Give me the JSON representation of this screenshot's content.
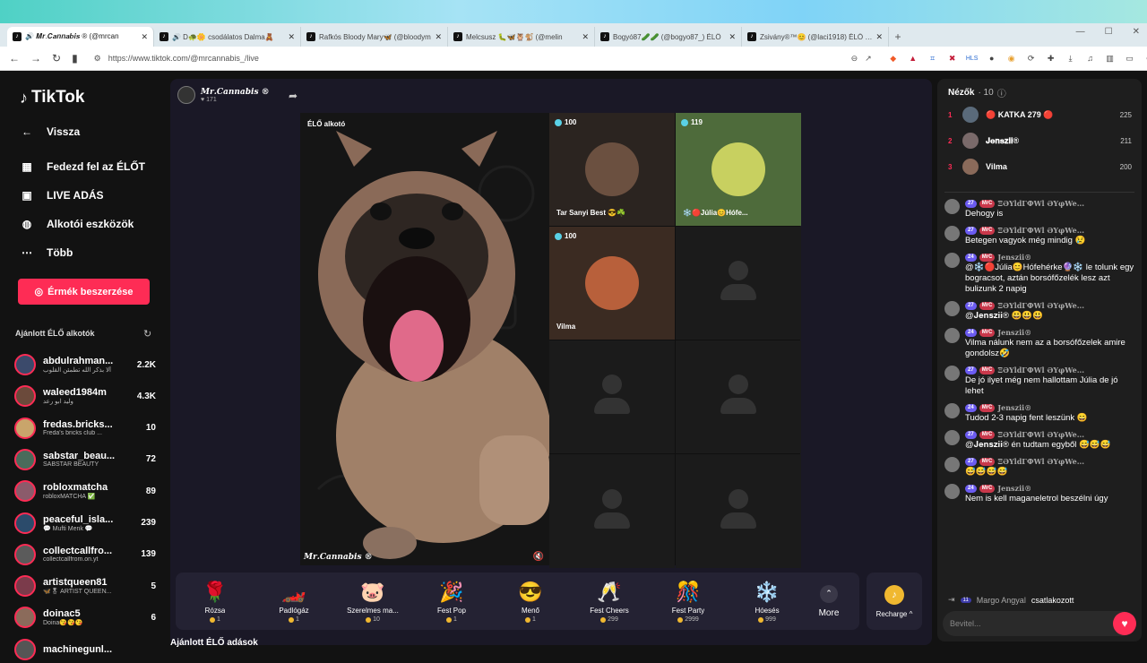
{
  "browser": {
    "tabs": [
      {
        "label": "🔊 𝑴𝒓.𝑪𝒂𝒏𝒏𝒂𝒃𝒊𝒔 ® (@mrcan",
        "active": true
      },
      {
        "label": "🔊 D🐢🌼 csodálatos Dalma🧸",
        "active": false
      },
      {
        "label": "Rafkós Bloody Mary🦋 (@bloodym",
        "active": false
      },
      {
        "label": "Melcsusz 🐛🦋🦉🐒 (@melin",
        "active": false
      },
      {
        "label": "Bogyó87🥒🥒 (@bogyo87_) ÉLŐ",
        "active": false
      },
      {
        "label": "Zsivány®™😊 (@laci1918) ÉLŐ adás",
        "active": false
      }
    ],
    "url": "https://www.tiktok.com/@mrcannabis_/live"
  },
  "sidebar": {
    "logo": "TikTok",
    "back": "Vissza",
    "nav": [
      {
        "label": "Fedezd fel az ÉLŐT",
        "icon": "calendar-icon"
      },
      {
        "label": "LIVE ADÁS",
        "icon": "camera-icon"
      },
      {
        "label": "Alkotói eszközök",
        "icon": "lightbulb-icon"
      },
      {
        "label": "Több",
        "icon": "more-icon"
      }
    ],
    "coins_button": "Érmék beszerzése",
    "recommended_header": "Ajánlott ÉLŐ alkotók",
    "creators": [
      {
        "name": "abdulrahman...",
        "sub": "ألا بذكر الله تطمئن القلوب",
        "count": "2.2K",
        "color": "#3b4a6b"
      },
      {
        "name": "waleed1984m",
        "sub": "وليد ابو رعد",
        "count": "4.3K",
        "color": "#6b4a3b"
      },
      {
        "name": "fredas.bricks...",
        "sub": "Freda's bricks club ...",
        "count": "10",
        "color": "#c9a56b"
      },
      {
        "name": "sabstar_beau...",
        "sub": "SABSTAR BEAUTY",
        "count": "72",
        "color": "#4a6b5b"
      },
      {
        "name": "robloxmatcha",
        "sub": "robloxMATCHA ✅",
        "count": "89",
        "color": "#8b5b6b"
      },
      {
        "name": "peaceful_isla...",
        "sub": "💬 Mufti Menk 💬",
        "count": "239",
        "color": "#2b4b6b"
      },
      {
        "name": "collectcallfro...",
        "sub": "collectcallfrom.on.yt",
        "count": "139",
        "color": "#5b5b5b"
      },
      {
        "name": "artistqueen81",
        "sub": "🦋🎖 ARTIST QUEEN...",
        "count": "5",
        "color": "#7b3b4b"
      },
      {
        "name": "doinac5",
        "sub": "Doina😘😘😘",
        "count": "6",
        "color": "#8b6b5b"
      },
      {
        "name": "machinegunl...",
        "sub": "",
        "count": "",
        "color": "#555"
      }
    ]
  },
  "live": {
    "host_name": "𝑴𝒓.𝑪𝒂𝒏𝒏𝒂𝒃𝒊𝒔 ®",
    "host_likes": "171",
    "stage_label": "ÉLŐ alkotó",
    "stage_watermark": "𝑴𝒓.𝑪𝒂𝒏𝒏𝒂𝒃𝒊𝒔 ®",
    "guests": [
      {
        "score": "100",
        "name": "Tar Sanyi Best 😎☘️",
        "filled": true,
        "bg": "#2b2420",
        "face": "#6b5040"
      },
      {
        "score": "119",
        "name": "❄️🔴Júlia😊Hófe...",
        "filled": true,
        "bg": "#4e6b3b",
        "face": "#c8d060"
      },
      {
        "score": "100",
        "name": "Vilma",
        "filled": true,
        "bg": "#3b2b22",
        "face": "#b8603b"
      },
      {
        "score": "",
        "name": "",
        "filled": false
      },
      {
        "score": "",
        "name": "",
        "filled": false
      },
      {
        "score": "",
        "name": "",
        "filled": false
      },
      {
        "score": "",
        "name": "",
        "filled": false
      },
      {
        "score": "",
        "name": "",
        "filled": false
      }
    ],
    "gifts": [
      {
        "name": "Rózsa",
        "price": "1",
        "icon": "🌹"
      },
      {
        "name": "Padlógáz",
        "price": "1",
        "icon": "🏎️"
      },
      {
        "name": "Szerelmes ma...",
        "price": "10",
        "icon": "🐷"
      },
      {
        "name": "Fest Pop",
        "price": "1",
        "icon": "🎉"
      },
      {
        "name": "Menő",
        "price": "1",
        "icon": "😎"
      },
      {
        "name": "Fest Cheers",
        "price": "299",
        "icon": "🥂"
      },
      {
        "name": "Fest Party",
        "price": "2999",
        "icon": "🎊"
      },
      {
        "name": "Hóesés",
        "price": "999",
        "icon": "❄️"
      }
    ],
    "more_label": "More",
    "recharge_label": "Recharge ^",
    "below_title": "Ajánlott ÉLŐ adások"
  },
  "viewers": {
    "title": "Nézők",
    "count": "· 10",
    "top": [
      {
        "rank": "1",
        "name": "🔴 KATKA 279 🔴",
        "score": "225"
      },
      {
        "rank": "2",
        "name": "𝐉𝐞𝐧𝐬𝐳𝐢𝐢®",
        "score": "211"
      },
      {
        "rank": "3",
        "name": "Vilma",
        "score": "200"
      }
    ]
  },
  "chat": {
    "messages": [
      {
        "level": "27",
        "fc": "MrC",
        "user": "ΞӘYldΓФWl ӘYφWe...",
        "text": "Dehogy is"
      },
      {
        "level": "27",
        "fc": "MrC",
        "user": "ΞӘYldΓФWl ӘYφWe...",
        "text": "Betegen vagyok még mindig 😢"
      },
      {
        "level": "24",
        "fc": "MrC",
        "user": "𝐉𝐞𝐧𝐬𝐳𝐢𝐢®",
        "text": "@❄️🔴Júlia😊Hófehérke🔮❄️ le tolunk egy bogracsot, aztán borsófőzelék lesz azt bulizunk 2 napig"
      },
      {
        "level": "27",
        "fc": "MrC",
        "user": "ΞӘYldΓФWl ӘYφWe...",
        "text": "@𝐉𝐞𝐧𝐬𝐳𝐢𝐢® 😃😃😃"
      },
      {
        "level": "24",
        "fc": "MrC",
        "user": "𝐉𝐞𝐧𝐬𝐳𝐢𝐢®",
        "text": "Vilma nálunk nem az a borsófőzelek amire gondolsz🤣"
      },
      {
        "level": "27",
        "fc": "MrC",
        "user": "ΞӘYldΓФWl ӘYφWe...",
        "text": "De jó ilyet még nem hallottam Júlia de jó lehet"
      },
      {
        "level": "24",
        "fc": "MrC",
        "user": "𝐉𝐞𝐧𝐬𝐳𝐢𝐢®",
        "text": "Tudod 2-3 napig fent leszünk 😄"
      },
      {
        "level": "27",
        "fc": "MrC",
        "user": "ΞӘYldΓФWl ӘYφWe...",
        "text": "@𝐉𝐞𝐧𝐬𝐳𝐢𝐢® én tudtam egyből 😅😅😅"
      },
      {
        "level": "27",
        "fc": "MrC",
        "user": "ΞӘYldΓФWl ӘYφWe...",
        "text": "😅😅😅😅"
      },
      {
        "level": "24",
        "fc": "MrC",
        "user": "𝐉𝐞𝐧𝐬𝐳𝐢𝐢®",
        "text": "Nem is kell maganeletrol beszélni úgy"
      }
    ],
    "join": {
      "level": "11",
      "user": "Margo Angyal",
      "text": "csatlakozott"
    },
    "input_placeholder": "Bevitel..."
  }
}
